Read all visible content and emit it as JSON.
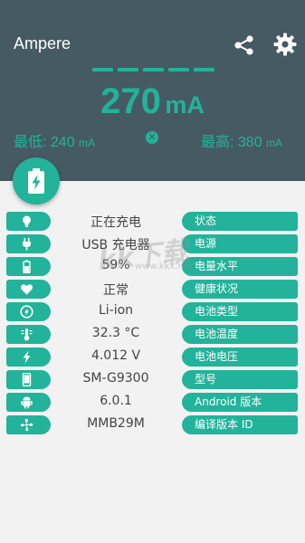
{
  "app": {
    "title": "Ampere"
  },
  "header": {
    "current_value": "270",
    "current_unit": "mA",
    "min_label": "最低: 240",
    "min_unit": "mA",
    "max_label": "最高: 380",
    "max_unit": "mA",
    "reset_glyph": "✕"
  },
  "colors": {
    "accent": "#22b39a",
    "header_bg": "#465a64",
    "background": "#f2f2f2"
  },
  "rows": [
    {
      "icon": "bulb-icon",
      "value": "正在充电",
      "label": "状态"
    },
    {
      "icon": "plug-icon",
      "value": "USB 充电器",
      "label": "电源"
    },
    {
      "icon": "battery-level-icon",
      "value": "59%",
      "label": "电量水平"
    },
    {
      "icon": "heart-icon",
      "value": "正常",
      "label": "健康状况"
    },
    {
      "icon": "battery-type-icon",
      "value": "Li-ion",
      "label": "电池类型"
    },
    {
      "icon": "thermometer-icon",
      "value": "32.3 °C",
      "label": "电池温度"
    },
    {
      "icon": "lightning-icon",
      "value": "4.012 V",
      "label": "电池电压"
    },
    {
      "icon": "phone-icon",
      "value": "SM-G9300",
      "label": "型号"
    },
    {
      "icon": "android-icon",
      "value": "6.0.1",
      "label": "Android 版本"
    },
    {
      "icon": "fan-icon",
      "value": "MMB29M",
      "label": "编译版本 ID"
    }
  ],
  "watermark": {
    "text": "kk下载",
    "sub": "www.kkx.net"
  }
}
